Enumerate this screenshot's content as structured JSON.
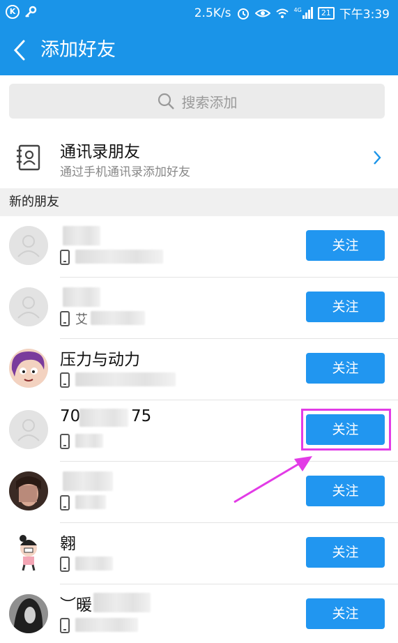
{
  "status_bar": {
    "speed": "2.5K/s",
    "signal_label": "4G",
    "battery": "21",
    "time": "下午3:39"
  },
  "nav": {
    "title": "添加好友"
  },
  "search": {
    "placeholder": "搜索添加"
  },
  "contacts": {
    "title": "通讯录朋友",
    "subtitle": "通过手机通讯录添加好友"
  },
  "section": {
    "label": "新的朋友"
  },
  "friends": [
    {
      "name": "",
      "sub": "",
      "avatar": "default"
    },
    {
      "name": "",
      "sub": "艾",
      "avatar": "default"
    },
    {
      "name": "压力与动力",
      "sub": "",
      "avatar": "cartoon"
    },
    {
      "name_prefix": "70",
      "name_suffix": "75",
      "sub": "",
      "avatar": "default"
    },
    {
      "name": "",
      "sub": "",
      "avatar": "photo"
    },
    {
      "name": "翱",
      "sub": "",
      "avatar": "figure"
    },
    {
      "name": "︶暖",
      "sub": "",
      "avatar": "photo-dark"
    }
  ],
  "follow_label": "关注",
  "colors": {
    "primary": "#1a94e8",
    "button": "#2196f0",
    "annotation": "#e23be6"
  },
  "icons": [
    "k-icon",
    "key-icon",
    "alarm-icon",
    "eye-icon",
    "wifi-icon",
    "signal-icon",
    "battery-icon",
    "back-icon",
    "search-icon",
    "contacts-book-icon",
    "chevron-right-icon",
    "phone-icon",
    "default-avatar-icon"
  ]
}
